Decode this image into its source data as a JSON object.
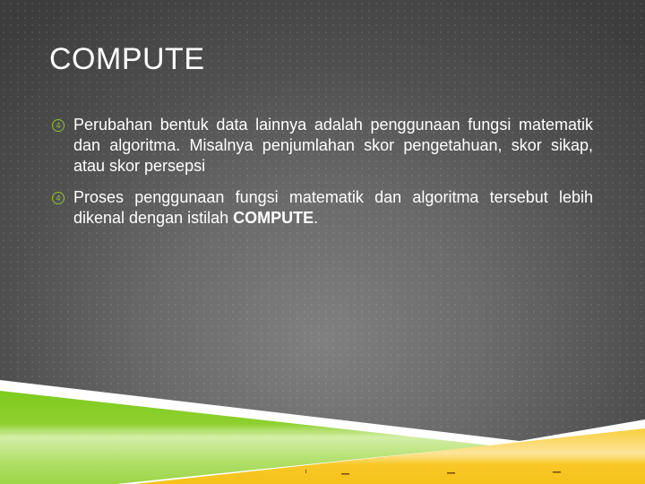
{
  "slide": {
    "title": "COMPUTE",
    "bullets": [
      {
        "icon": "circled-4-bullet-icon",
        "icon_glyph": "4",
        "text": "Perubahan bentuk data lainnya adalah penggunaan fungsi matematik dan algoritma. Misalnya penjumlahan skor pengetahuan, skor sikap, atau skor persepsi"
      },
      {
        "icon": "circled-4-bullet-icon",
        "icon_glyph": "4",
        "text_before": "Proses penggunaan fungsi matematik dan algoritma tersebut lebih dikenal dengan istilah ",
        "text_bold": "COMPUTE",
        "text_after": "."
      }
    ]
  },
  "theme": {
    "accent_green": "#8fc43a",
    "accent_yellow": "#f7c21c",
    "band_white": "#ffffff",
    "background_dark": "#3a3a3a",
    "background_light": "#808080"
  }
}
